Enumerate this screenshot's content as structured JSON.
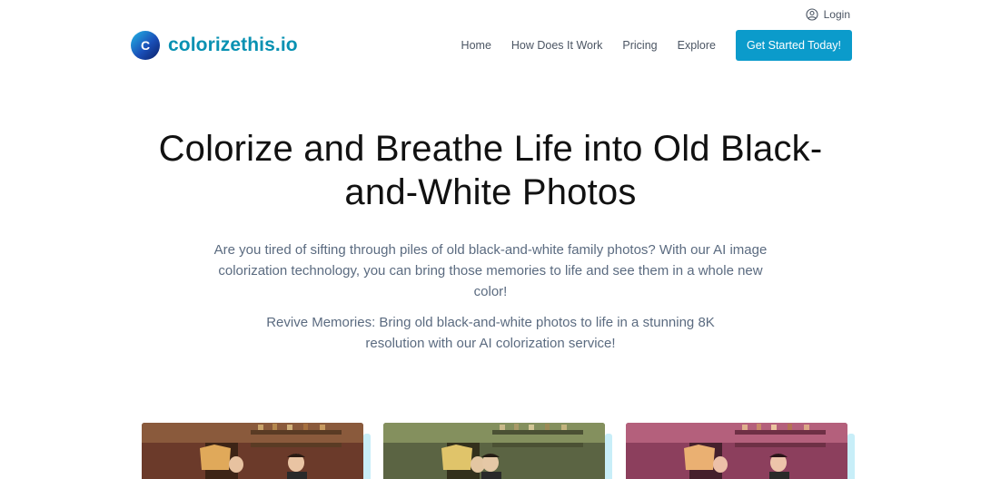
{
  "topbar": {
    "login_label": "Login",
    "user_icon": "user-circle-icon"
  },
  "brand": {
    "name": "colorizethis.io",
    "logo_icon": "brand-logo-icon",
    "logo_letter": "C",
    "color": "#0891b2"
  },
  "nav": {
    "items": [
      {
        "label": "Home"
      },
      {
        "label": "How Does It Work"
      },
      {
        "label": "Pricing"
      },
      {
        "label": "Explore"
      }
    ],
    "cta_label": "Get Started Today!",
    "cta_color": "#0b9bcb"
  },
  "hero": {
    "title": "Colorize and Breathe Life into Old Black-and-White Photos",
    "lead": "Are you tired of sifting through piles of old black-and-white family photos? With our AI image colorization technology, you can bring those memories to life and see them in a whole new color!",
    "sub": "Revive Memories: Bring old black-and-white photos to life in a stunning 8K resolution with our AI colorization service!"
  },
  "gallery": {
    "cards": [
      {
        "name": "colorized-photo-1",
        "tint": "#8b3c2c"
      },
      {
        "name": "colorized-photo-2",
        "tint": "#6f7a50"
      },
      {
        "name": "colorized-photo-3",
        "tint": "#9c4a6c"
      }
    ]
  }
}
